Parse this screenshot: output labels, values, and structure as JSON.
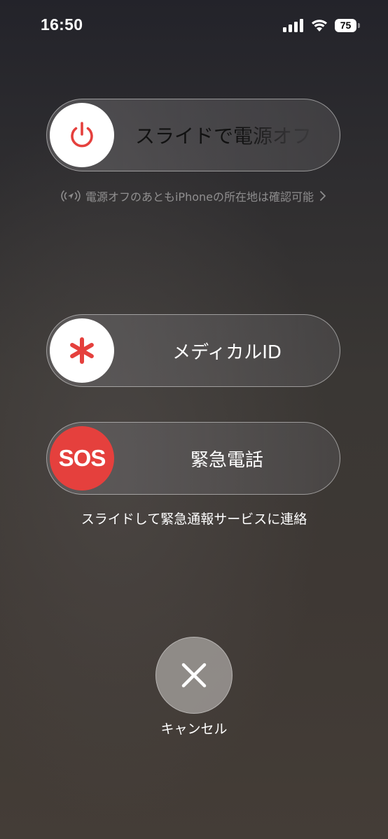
{
  "status_bar": {
    "time": "16:50",
    "battery": "75",
    "icons": [
      "signal-icon",
      "wifi-icon",
      "battery-icon"
    ]
  },
  "power": {
    "label": "スライドで電源オフ",
    "icon": "power-icon",
    "accent_color": "#e5403d"
  },
  "find_my": {
    "text": "電源オフのあともiPhoneの所在地は確認可能",
    "icons": [
      "location-icon",
      "chevron-right-icon"
    ]
  },
  "medical": {
    "label": "メディカルID",
    "icon": "asterisk-icon"
  },
  "sos": {
    "knob_label": "SOS",
    "label": "緊急電話",
    "note": "スライドして緊急通報サービスに連絡",
    "knob_color": "#e5403d"
  },
  "cancel": {
    "label": "キャンセル",
    "icon": "close-icon"
  }
}
